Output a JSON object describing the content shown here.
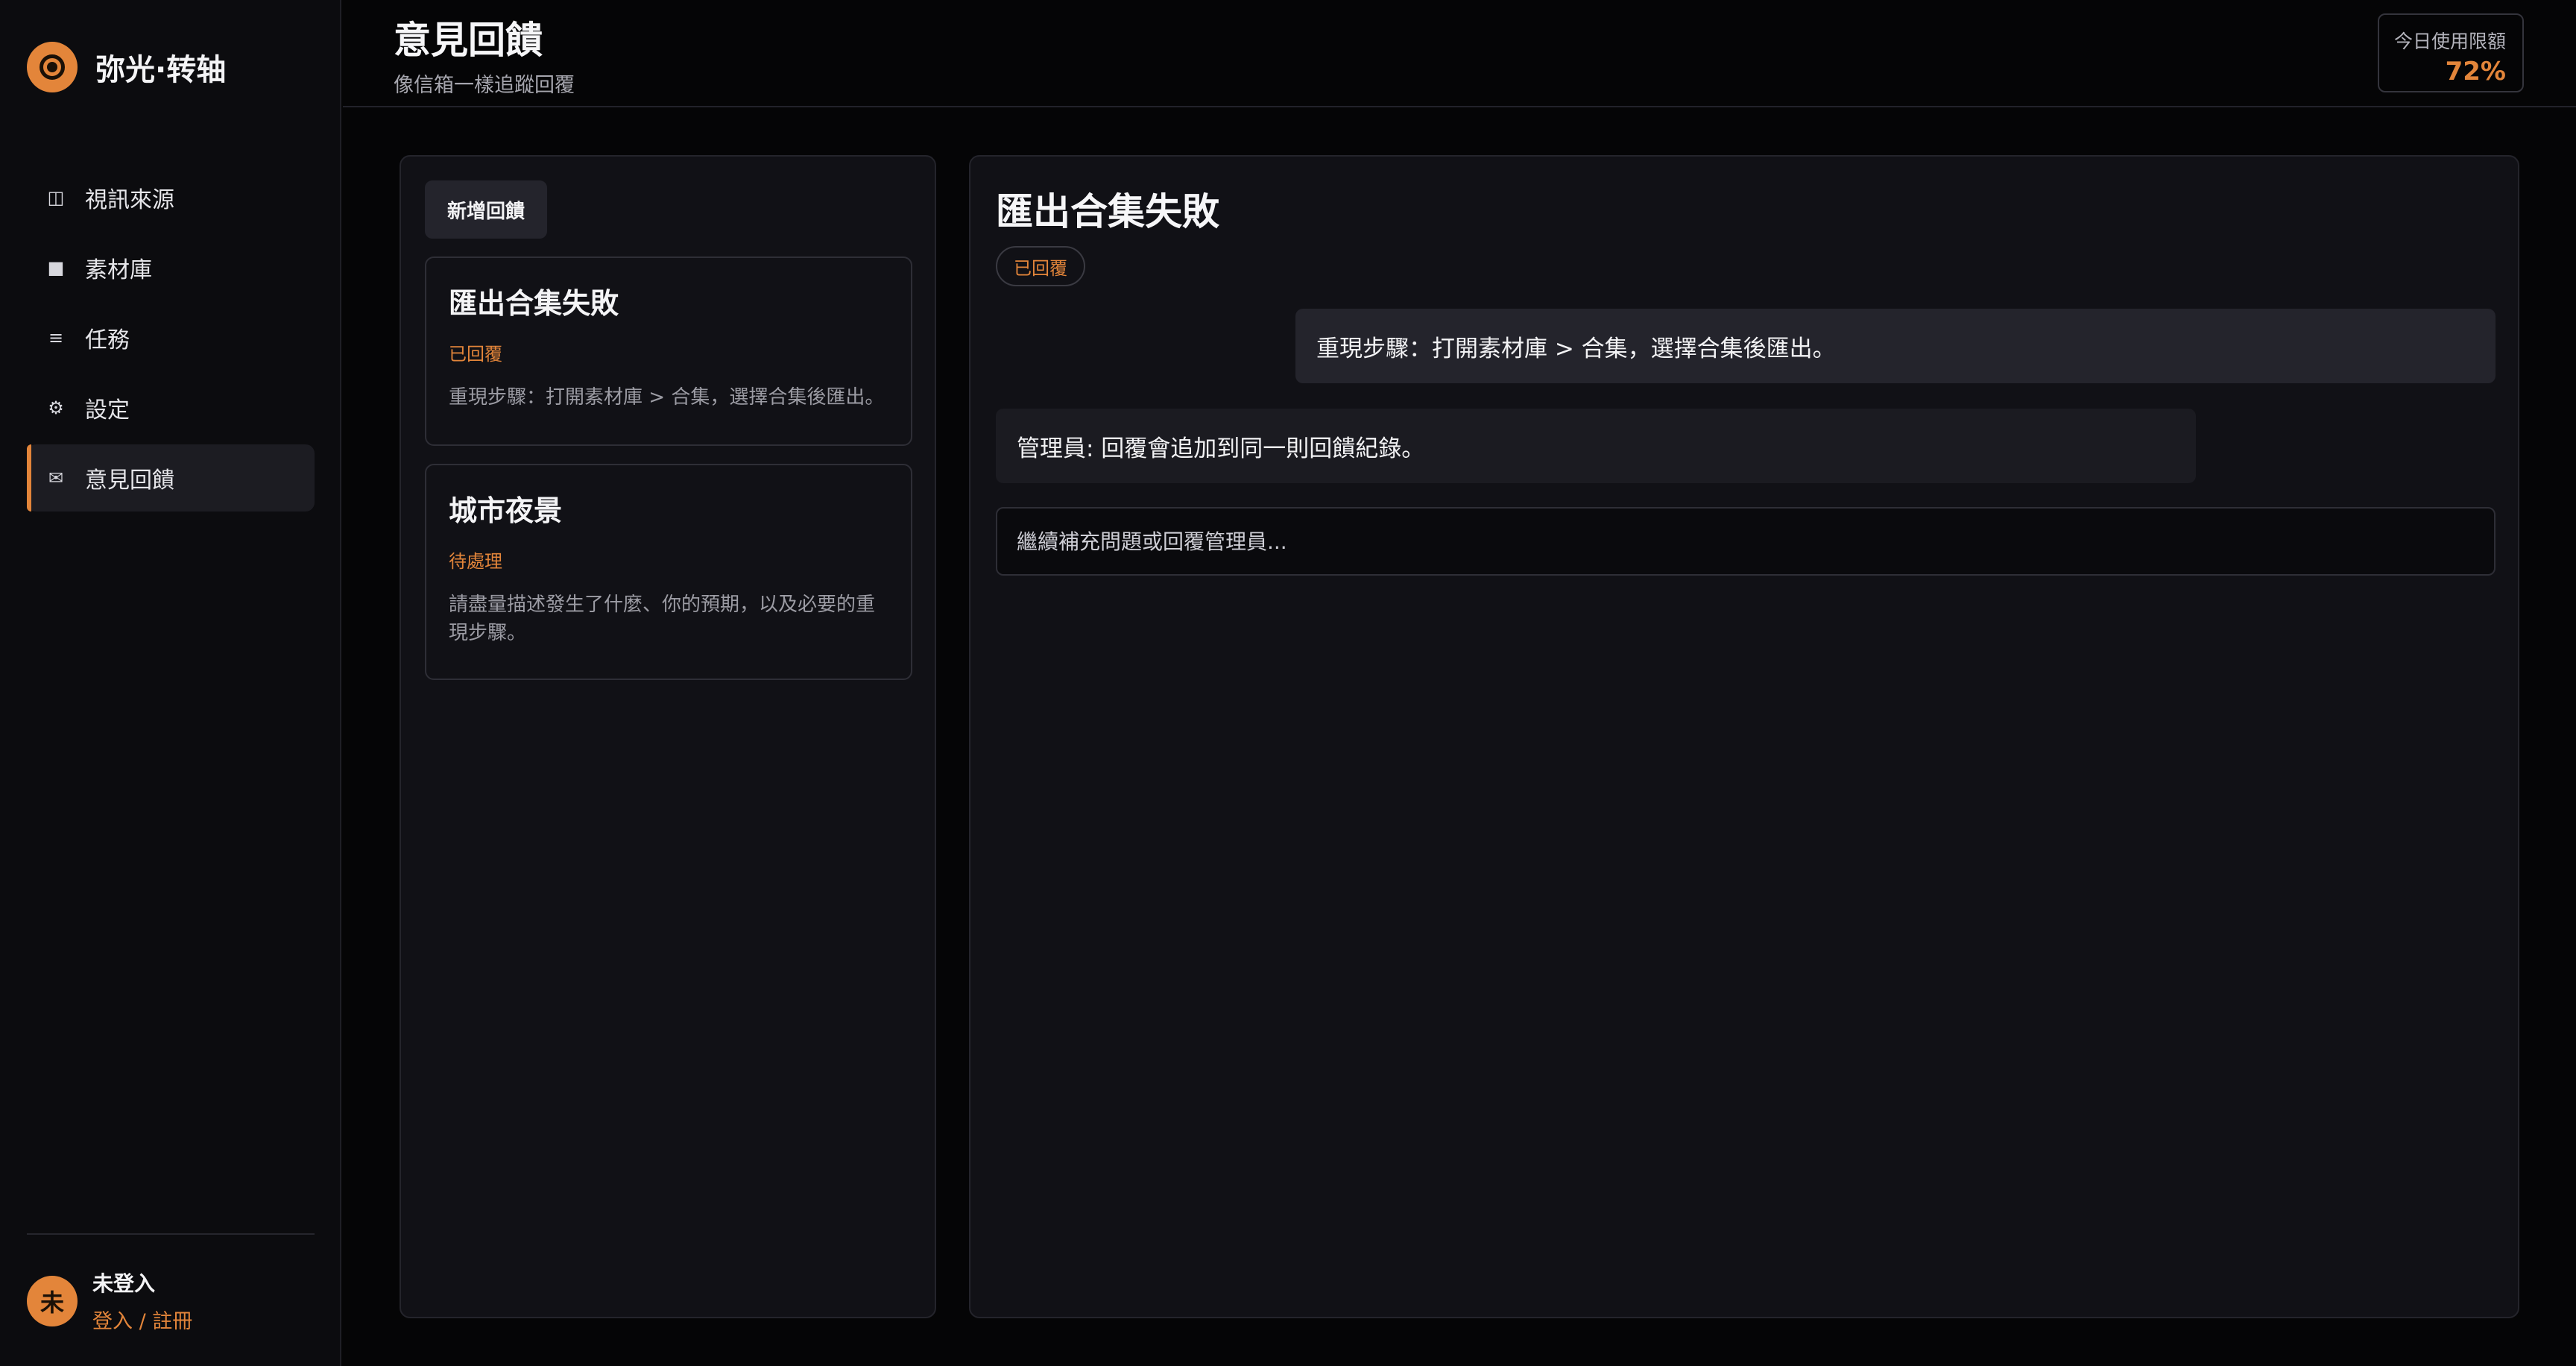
{
  "app": {
    "name": "弥光·转轴",
    "logo_icon": "orbit-logo-icon"
  },
  "colors": {
    "accent": "#e3853a",
    "background": "#050506",
    "panel": "#111116",
    "sidebar": "#0c0c0f"
  },
  "sidebar": {
    "items": [
      {
        "label": "視訊來源",
        "icon": "video-source-icon",
        "glyph": "◫",
        "active": false
      },
      {
        "label": "素材庫",
        "icon": "library-icon",
        "glyph": "■",
        "active": false
      },
      {
        "label": "任務",
        "icon": "tasks-icon",
        "glyph": "≡",
        "active": false
      },
      {
        "label": "設定",
        "icon": "gear-icon",
        "glyph": "⚙",
        "active": false
      },
      {
        "label": "意見回饋",
        "icon": "mail-icon",
        "glyph": "✉",
        "active": true
      }
    ],
    "user": {
      "avatar_text": "未",
      "name": "未登入",
      "login_link": "登入 / 註冊"
    }
  },
  "header": {
    "title": "意見回饋",
    "subtitle": "像信箱一樣追蹤回覆",
    "quota_label": "今日使用限額",
    "quota_value": "72%"
  },
  "list": {
    "new_button": "新增回饋",
    "cards": [
      {
        "title": "匯出合集失敗",
        "status": "已回覆",
        "desc": "重現步驟：打開素材庫 > 合集，選擇合集後匯出。"
      },
      {
        "title": "城市夜景",
        "status": "待處理",
        "desc": "請盡量描述發生了什麼、你的預期，以及必要的重現步驟。"
      }
    ]
  },
  "detail": {
    "title": "匯出合集失敗",
    "status": "已回覆",
    "messages": {
      "user": "重現步驟：打開素材庫 > 合集，選擇合集後匯出。",
      "admin": "管理員: 回覆會追加到同一則回饋紀錄。"
    },
    "reply_placeholder": "繼續補充問題或回覆管理員..."
  }
}
